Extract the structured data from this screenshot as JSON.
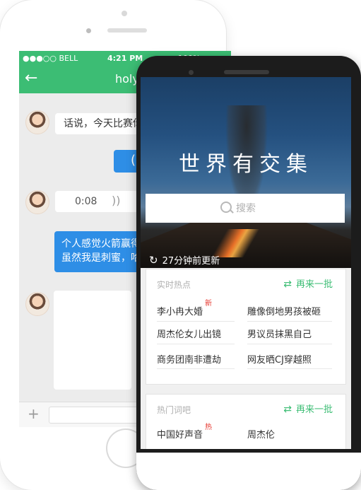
{
  "chat_app": {
    "status": {
      "carrier": "●●●○○ BELL",
      "time": "4:21 PM",
      "battery": "100%"
    },
    "nav": {
      "back": "←",
      "title": "holy"
    },
    "messages": [
      {
        "text": "话说，今天比赛你"
      },
      {
        "text": "("
      },
      {
        "voice_duration": "0:08",
        "voice_icon": "))"
      },
      {
        "line1": "个人感觉火箭赢得",
        "line2": "虽然我是刺蜜，哈"
      }
    ],
    "input": {
      "plus": "+"
    }
  },
  "search_app": {
    "hero": {
      "title": "世界有交集",
      "search_placeholder": "搜索",
      "update_text": "27分钟前更新"
    },
    "sections": [
      {
        "header": "实时热点",
        "refresh_label": "再来一批",
        "items": [
          {
            "text": "李小冉大婚",
            "badge": "新"
          },
          {
            "text": "雕像倒地男孩被砸"
          },
          {
            "text": "周杰伦女儿出镜"
          },
          {
            "text": "男议员抹黑自己"
          },
          {
            "text": "商务团南非遭劫"
          },
          {
            "text": "网友晒CJ穿越照"
          }
        ]
      },
      {
        "header": "热门词吧",
        "refresh_label": "再来一批",
        "items": [
          {
            "text": "中国好声音",
            "badge": "热"
          },
          {
            "text": "周杰伦"
          }
        ]
      }
    ],
    "colors": {
      "accent": "#3cbd74",
      "badge": "#e6382f",
      "chat_bubble": "#2e8ee6"
    }
  }
}
